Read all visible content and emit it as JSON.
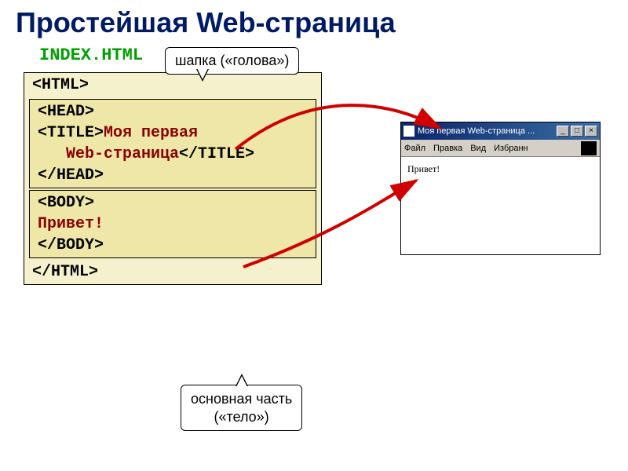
{
  "title": "Простейшая Web-страница",
  "filename": "INDEX.HTML",
  "code": {
    "html_open": "<HTML>",
    "head_open": "<HEAD>",
    "title_open": "<TITLE>",
    "title_text1": "Моя первая",
    "title_text2": "Web-страница",
    "title_close": "</TITLE>",
    "head_close": "</HEAD>",
    "body_open": "<BODY>",
    "body_text": "Привет!",
    "body_close": "</BODY>",
    "html_close": "</HTML>"
  },
  "callouts": {
    "head": "шапка («голова»)",
    "body_l1": "основная часть",
    "body_l2": "(«тело»)"
  },
  "browser": {
    "title": "Моя первая Web-страница ...",
    "menu": {
      "file": "Файл",
      "edit": "Правка",
      "view": "Вид",
      "fav": "Избранн"
    },
    "winbtns": {
      "min": "_",
      "max": "□",
      "close": "×"
    },
    "content": "Привет!"
  }
}
